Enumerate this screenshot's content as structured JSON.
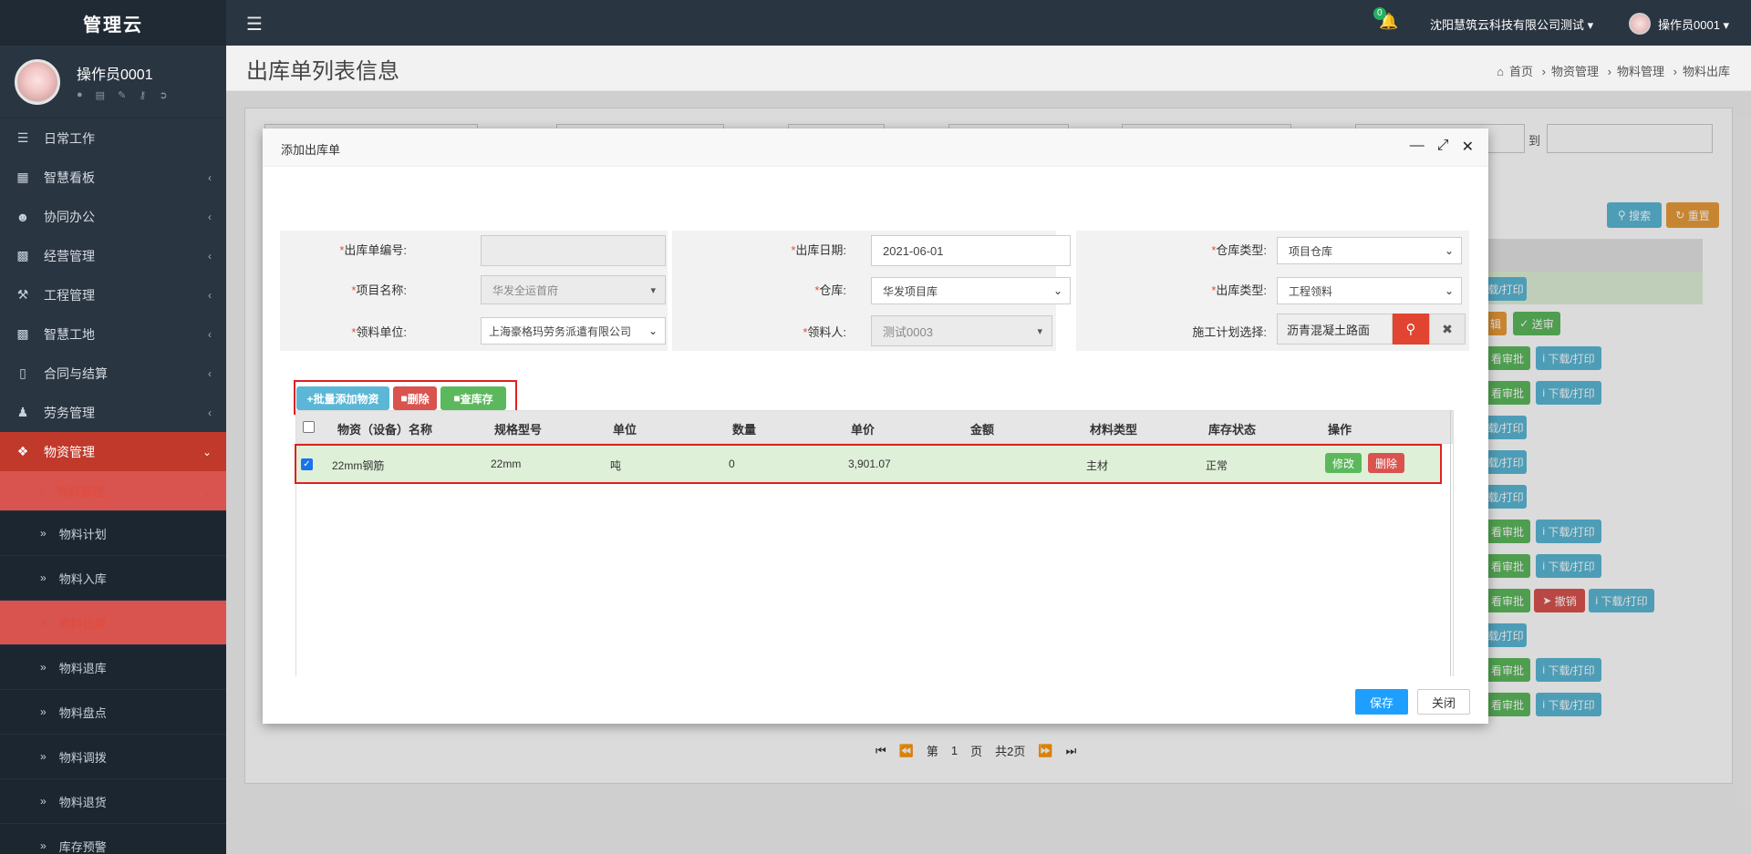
{
  "app": {
    "brand": "管理云"
  },
  "user": {
    "name": "操作员0001",
    "tool_icons": [
      "user-icon",
      "id-card-icon",
      "edit-icon",
      "key-icon",
      "logout-icon"
    ]
  },
  "sidebar": {
    "items": [
      {
        "label": "日常工作",
        "icon": "list-icon"
      },
      {
        "label": "智慧看板",
        "icon": "dashboard-icon"
      },
      {
        "label": "协同办公",
        "icon": "users-icon"
      },
      {
        "label": "经营管理",
        "icon": "desktop-icon"
      },
      {
        "label": "工程管理",
        "icon": "gavel-icon"
      },
      {
        "label": "智慧工地",
        "icon": "monitor-icon"
      },
      {
        "label": "合同与结算",
        "icon": "file-icon"
      },
      {
        "label": "劳务管理",
        "icon": "worker-icon"
      },
      {
        "label": "物资管理",
        "icon": "cube-icon"
      }
    ],
    "sub_items": [
      {
        "label": "物料管理"
      },
      {
        "label": "物料计划"
      },
      {
        "label": "物料入库"
      },
      {
        "label": "物料出库"
      },
      {
        "label": "物料退库"
      },
      {
        "label": "物料盘点"
      },
      {
        "label": "物料调拨"
      },
      {
        "label": "物料退货"
      },
      {
        "label": "库存预警"
      }
    ]
  },
  "topbar": {
    "notification_count": "0",
    "company": "沈阳慧筑云科技有限公司测试",
    "user": "操作员0001"
  },
  "page": {
    "title": "出库单列表信息",
    "breadcrumb": [
      "首页",
      "物资管理",
      "物料管理",
      "物料出库"
    ]
  },
  "background": {
    "range_to": "到",
    "search_label": "搜索",
    "reset_label": "重置",
    "row_buttons": {
      "download_print": "下载/打印",
      "view_approve": "看审批",
      "submit": "送审",
      "revoke": "撤销",
      "edit_partial": "辑",
      "download_partial": "载/打印"
    },
    "pager": {
      "page_prefix": "第",
      "page_no": "1",
      "page_suffix": "页",
      "total": "共2页"
    }
  },
  "modal": {
    "title": "添加出库单",
    "form": {
      "order_no": {
        "label": "出库单编号:",
        "value": ""
      },
      "out_date": {
        "label": "出库日期:",
        "value": "2021-06-01"
      },
      "warehouse_type": {
        "label": "仓库类型:",
        "value": "项目仓库"
      },
      "project_name": {
        "label": "项目名称:",
        "value": "华发全运首府"
      },
      "warehouse": {
        "label": "仓库:",
        "value": "华发项目库"
      },
      "out_type": {
        "label": "出库类型:",
        "value": "工程领料"
      },
      "receiving_unit": {
        "label": "领料单位:",
        "value": "上海豪格玛劳务派遣有限公司"
      },
      "receiver": {
        "label": "领料人:",
        "value": "测试0003"
      },
      "construction_plan": {
        "label": "施工计划选择:",
        "value": "沥青混凝土路面"
      }
    },
    "toolbar": {
      "batch_add": "+批量添加物资",
      "delete": "删除",
      "check_stock": "查库存"
    },
    "grid": {
      "columns": [
        "物资（设备）名称",
        "规格型号",
        "单位",
        "数量",
        "单价",
        "金额",
        "材料类型",
        "库存状态",
        "操作"
      ],
      "rows": [
        {
          "name": "22mm钢筋",
          "spec": "22mm",
          "unit": "吨",
          "qty": "0",
          "price": "3,901.07",
          "amount": "",
          "material_type": "主材",
          "stock_status": "正常",
          "edit": "修改",
          "delete": "删除"
        }
      ]
    },
    "save_label": "保存",
    "close_label": "关闭"
  }
}
